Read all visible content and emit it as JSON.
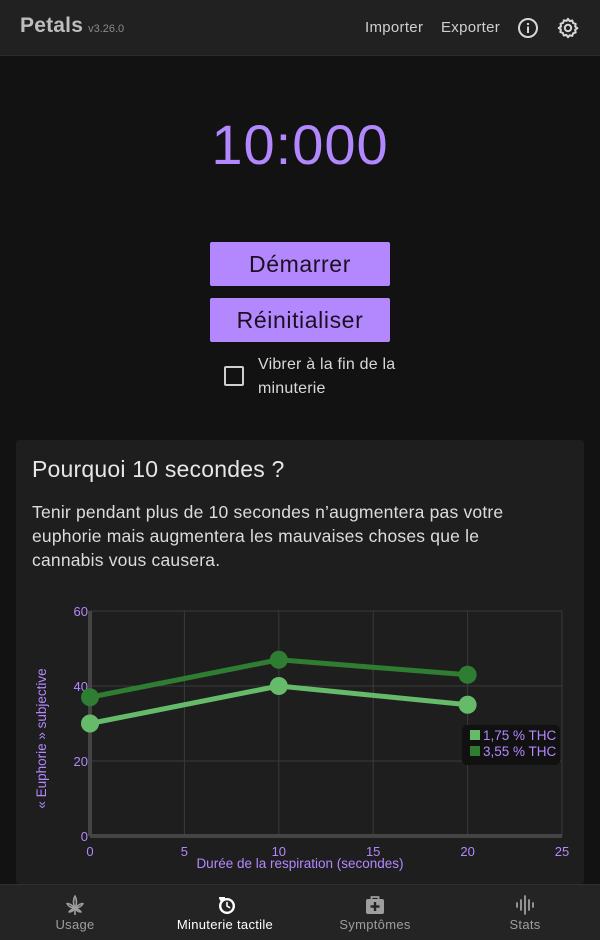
{
  "app": {
    "name": "Petals",
    "version": "v3.26.0"
  },
  "header": {
    "import_label": "Importer",
    "export_label": "Exporter",
    "info_icon": "info-icon",
    "settings_icon": "gear-icon"
  },
  "timer": {
    "display": "10:000"
  },
  "controls": {
    "start_label": "Démarrer",
    "reset_label": "Réinitialiser",
    "vibrate_label": "Vibrer à la fin de la minuterie",
    "vibrate_checked": false
  },
  "info_card": {
    "title": "Pourquoi 10 secondes ?",
    "text": "Tenir pendant plus de 10 secondes n’augmentera pas votre euphorie mais augmentera les mauvaises choses que le cannabis vous causera."
  },
  "chart_data": {
    "type": "line",
    "xlabel": "Durée de la respiration (secondes)",
    "ylabel": "« Euphorie » subjective",
    "xlim": [
      0,
      25
    ],
    "ylim": [
      0,
      60
    ],
    "xticks": [
      0,
      5,
      10,
      15,
      20,
      25
    ],
    "yticks": [
      0,
      20,
      40,
      60
    ],
    "grid": true,
    "legend_position": "right",
    "series": [
      {
        "name": "1,75 % THC",
        "color": "#66bb6a",
        "x": [
          0,
          10,
          20
        ],
        "y": [
          30,
          40,
          35
        ]
      },
      {
        "name": "3,55 % THC",
        "color": "#2e7d32",
        "x": [
          0,
          10,
          20
        ],
        "y": [
          37,
          47,
          43
        ]
      }
    ]
  },
  "bottom_nav": {
    "items": [
      {
        "label": "Usage",
        "icon": "cannabis-leaf-icon",
        "active": false
      },
      {
        "label": "Minuterie tactile",
        "icon": "timer-clock-icon",
        "active": true
      },
      {
        "label": "Symptômes",
        "icon": "medical-kit-icon",
        "active": false
      },
      {
        "label": "Stats",
        "icon": "stats-waveform-icon",
        "active": false
      }
    ]
  }
}
